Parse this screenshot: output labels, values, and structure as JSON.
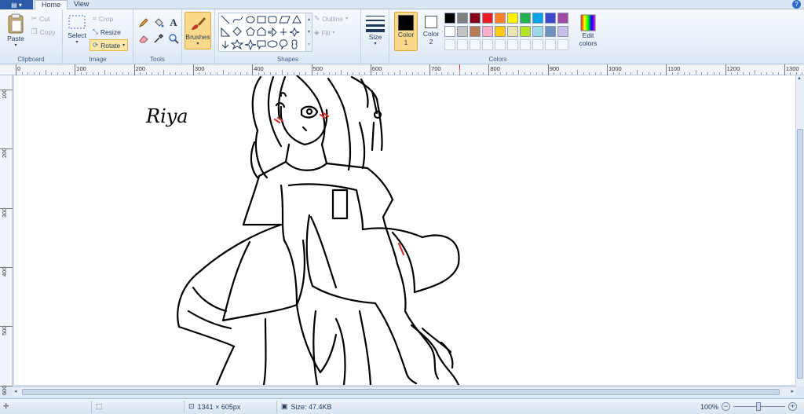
{
  "tabs": {
    "home": "Home",
    "view": "View"
  },
  "clipboard": {
    "paste": "Paste",
    "cut": "Cut",
    "copy": "Copy",
    "label": "Clipboard"
  },
  "image": {
    "select": "Select",
    "crop": "Crop",
    "resize": "Resize",
    "rotate": "Rotate",
    "label": "Image"
  },
  "tools": {
    "label": "Tools",
    "text_tool": "A"
  },
  "brushes": {
    "label": "Brushes"
  },
  "shapes": {
    "label": "Shapes",
    "outline": "Outline",
    "fill": "Fill"
  },
  "size": {
    "label": "Size"
  },
  "colors": {
    "color1_label": "Color",
    "color1_num": "1",
    "color2_label": "Color",
    "color2_num": "2",
    "edit_label": "Edit",
    "edit_label2": "colors",
    "group_label": "Colors",
    "color1": "#000000",
    "color2": "#ffffff",
    "palette_row1": [
      "#000000",
      "#7f7f7f",
      "#880015",
      "#ed1c24",
      "#ff7f27",
      "#fff200",
      "#22b14c",
      "#00a2e8",
      "#3f48cc",
      "#a349a4"
    ],
    "palette_row2": [
      "#ffffff",
      "#c3c3c3",
      "#b97a57",
      "#ffaec9",
      "#ffc90e",
      "#efe4b0",
      "#b5e61d",
      "#99d9ea",
      "#7092be",
      "#c8bfe7"
    ]
  },
  "ruler": {
    "h_labels": [
      "0",
      "100",
      "200",
      "300",
      "400",
      "500",
      "600",
      "700",
      "800",
      "900",
      "1000",
      "1100",
      "1200",
      "1300"
    ],
    "v_labels": [
      "100",
      "200",
      "300",
      "400",
      "500",
      "600"
    ]
  },
  "drawing": {
    "signature": "Riya"
  },
  "status": {
    "dimensions": "1341 × 605px",
    "size": "Size: 47.4KB",
    "zoom": "100%"
  }
}
